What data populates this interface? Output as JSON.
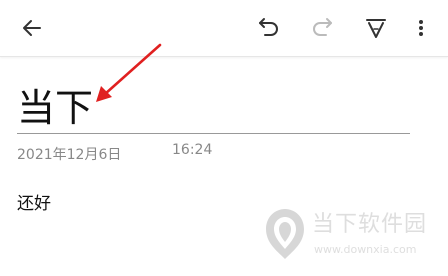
{
  "toolbar": {
    "back_icon": "arrow-left-icon",
    "undo_icon": "undo-icon",
    "redo_icon": "redo-icon",
    "pen_icon": "pen-icon",
    "more_icon": "more-vertical-icon",
    "redo_enabled": false
  },
  "note": {
    "title": "当下",
    "date": "2021年12月6日",
    "time": "16:24",
    "body": "还好"
  },
  "watermark": {
    "site_name": "当下软件园",
    "url": "www.downxia.com"
  },
  "colors": {
    "annotation_arrow": "#e02020",
    "icon": "#333333",
    "icon_disabled": "#bbbbbb",
    "meta_text": "#888888"
  }
}
